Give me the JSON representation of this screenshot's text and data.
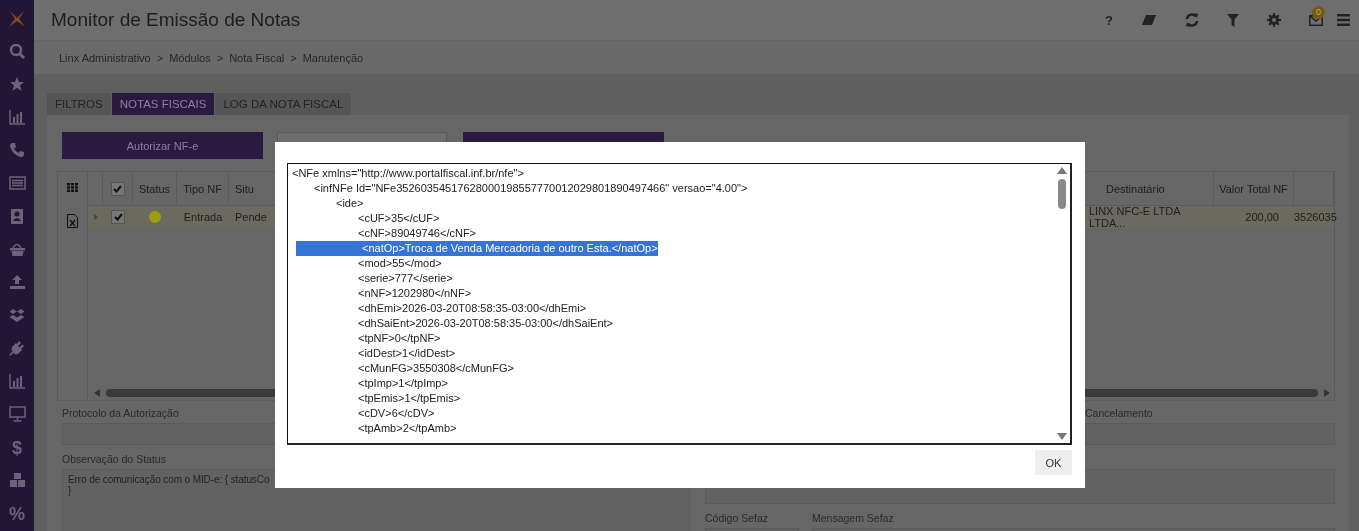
{
  "sidebar": {
    "items": [
      {
        "kind": "logo"
      },
      {
        "kind": "icon"
      },
      {
        "kind": "icon"
      },
      {
        "kind": "icon"
      },
      {
        "kind": "icon"
      },
      {
        "kind": "icon"
      },
      {
        "kind": "icon"
      },
      {
        "kind": "icon"
      },
      {
        "kind": "icon"
      },
      {
        "kind": "icon"
      },
      {
        "kind": "icon"
      },
      {
        "kind": "icon"
      },
      {
        "kind": "icon"
      },
      {
        "kind": "glyph",
        "text": "$"
      },
      {
        "kind": "icon"
      },
      {
        "kind": "glyph",
        "text": "%"
      }
    ]
  },
  "header": {
    "title": "Monitor de Emissão de Notas",
    "help_label": "?",
    "notification_count": "0"
  },
  "breadcrumb": {
    "separator": ">",
    "items": [
      "Linx Administrativo",
      "Módulos",
      "Nota Fiscal",
      "Manutenção"
    ]
  },
  "tabs": [
    {
      "label": "FILTROS",
      "selected": false
    },
    {
      "label": "NOTAS FISCAIS",
      "selected": true
    },
    {
      "label": "LOG DA NOTA FISCAL",
      "selected": false
    }
  ],
  "toolbar": {
    "buttons": [
      {
        "kind": "primary",
        "label": "Autorizar NF-e"
      },
      {
        "kind": "secondary"
      },
      {
        "kind": "primary"
      }
    ]
  },
  "table": {
    "select_all_checked": true,
    "columns": [
      "Status",
      "Tipo NF",
      "Situ",
      "Destinatário",
      "Valor Total NF"
    ],
    "rows": [
      {
        "checked": true,
        "color": "#a09c14",
        "cells": [
          "",
          "Entrada",
          "Pende",
          "LINX NFC-E LTDA LTDA...",
          "200,00",
          "3526035"
        ]
      }
    ]
  },
  "form": {
    "protocol_label": "Protocolo da Autorização",
    "status_note_label": "Observação do Status",
    "status_note_value": "Erro de comunicação com o MID-e: { statusCo\n}",
    "cancel_label": "Cancelamento",
    "sefaz_code_label": "Código Sefaz",
    "sefaz_message_label": "Mensagem Sefaz"
  },
  "modal": {
    "ok_label": "OK",
    "xml": [
      {
        "text": "<NFe xmlns=\"http://www.portalfiscal.inf.br/nfe\">",
        "selected": false,
        "children": [
          {
            "text": "<infNFe Id=\"NFe35260354517628000198557770012029801890497466\" versao=\"4.00\">",
            "selected": false,
            "children": [
              {
                "text": "<ide>",
                "selected": false,
                "children": [
                  {
                    "text": "<cUF>35</cUF>",
                    "selected": false
                  },
                  {
                    "text": "<cNF>89049746</cNF>",
                    "selected": false
                  },
                  {
                    "text": "<natOp>Troca de Venda Mercadoria de outro Esta.</natOp>",
                    "selected": true
                  },
                  {
                    "text": "<mod>55</mod>",
                    "selected": false
                  },
                  {
                    "text": "<serie>777</serie>",
                    "selected": false
                  },
                  {
                    "text": "<nNF>1202980</nNF>",
                    "selected": false
                  },
                  {
                    "text": "<dhEmi>2026-03-20T08:58:35-03:00</dhEmi>",
                    "selected": false
                  },
                  {
                    "text": "<dhSaiEnt>2026-03-20T08:58:35-03:00</dhSaiEnt>",
                    "selected": false
                  },
                  {
                    "text": "<tpNF>0</tpNF>",
                    "selected": false
                  },
                  {
                    "text": "<idDest>1</idDest>",
                    "selected": false
                  },
                  {
                    "text": "<cMunFG>3550308</cMunFG>",
                    "selected": false
                  },
                  {
                    "text": "<tpImp>1</tpImp>",
                    "selected": false
                  },
                  {
                    "text": "<tpEmis>1</tpEmis>",
                    "selected": false
                  },
                  {
                    "text": "<cDV>6</cDV>",
                    "selected": false
                  },
                  {
                    "text": "<tpAmb>2</tpAmb>",
                    "selected": false
                  }
                ]
              }
            ]
          }
        ]
      }
    ]
  }
}
